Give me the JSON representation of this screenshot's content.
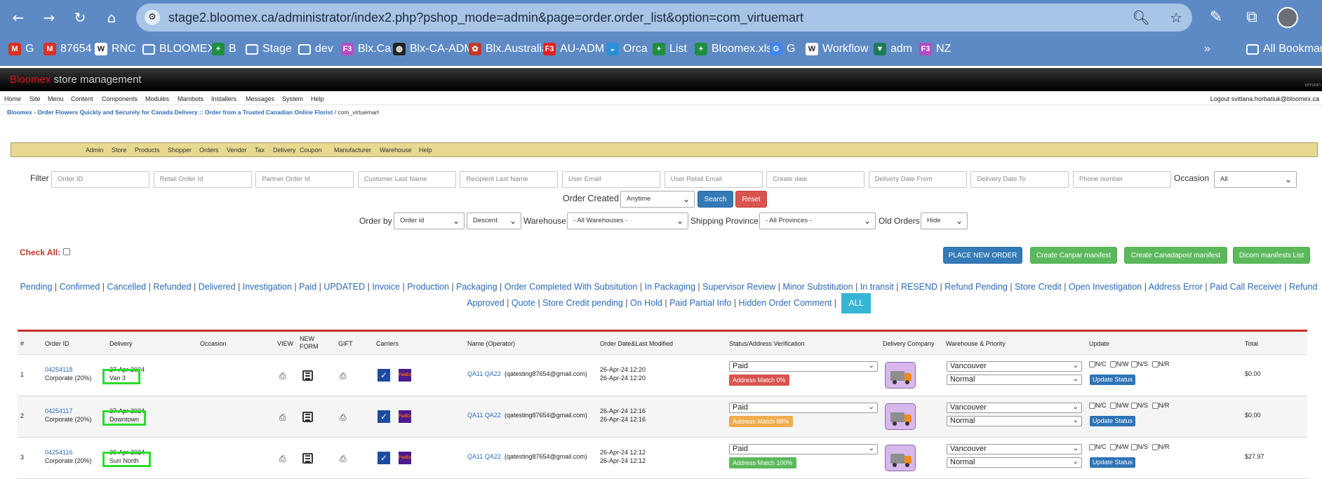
{
  "browser": {
    "url": "stage2.bloomex.ca/administrator/index2.php?pshop_mode=admin&page=order.order_list&option=com_virtuemart",
    "bookmarks": [
      {
        "label": "G",
        "icon": "gmail-icon",
        "color": "#d93025"
      },
      {
        "label": "87654",
        "icon": "gmail-icon",
        "color": "#d93025"
      },
      {
        "label": "RNC",
        "icon": "wiki-icon",
        "color": "#ffffff"
      },
      {
        "label": "BLOOMEX",
        "icon": "folder-icon",
        "color": "#ffffff"
      },
      {
        "label": "B",
        "icon": "sheets-icon",
        "color": "#1e8e3e"
      },
      {
        "label": "Stage",
        "icon": "folder-icon",
        "color": "#ffffff"
      },
      {
        "label": "dev",
        "icon": "folder-icon",
        "color": "#ffffff"
      },
      {
        "label": "Blx.Ca",
        "icon": "f3-icon",
        "color": "#b04fc4"
      },
      {
        "label": "Blx-CA-ADM",
        "icon": "globe-icon",
        "color": "#222222"
      },
      {
        "label": "Blx.Australia",
        "icon": "bloomex-icon",
        "color": "#c0392b"
      },
      {
        "label": "AU-ADM",
        "icon": "f3-icon",
        "color": "#e02020"
      },
      {
        "label": "Orca",
        "icon": "orca-icon",
        "color": "#2a8fd8"
      },
      {
        "label": "List",
        "icon": "sheets-icon",
        "color": "#1e8e3e"
      },
      {
        "label": "Bloomex.xlsx",
        "icon": "sheets-icon",
        "color": "#1e8e3e"
      },
      {
        "label": "G",
        "icon": "translate-icon",
        "color": "#4285f4"
      },
      {
        "label": "Workflow",
        "icon": "wiki-icon",
        "color": "#ffffff"
      },
      {
        "label": "adm",
        "icon": "vuetify-icon",
        "color": "#1f7a5a"
      },
      {
        "label": "NZ",
        "icon": "f3-icon",
        "color": "#b04fc4"
      }
    ],
    "overflow_label": "»",
    "all_bookmarks": "All Bookmarks"
  },
  "app": {
    "brand": "Bloomex",
    "title_rest": " store management",
    "version": "version",
    "menu": [
      "Home",
      "Site",
      "Menu",
      "Content",
      "Components",
      "Modules",
      "Mambots",
      "Installers",
      "Messages",
      "System",
      "Help"
    ],
    "logout": "Logout svitlana.horbatiuk@bloomex.ca",
    "breadcrumb_link": "Bloomex - Order Flowers Quickly and Securely for Canada Delivery :: Order from a Trusted Canadian Online Florist",
    "breadcrumb_rest": " / com_virtuemart",
    "submenu": [
      "Admin",
      "Store",
      "Products",
      "Shopper",
      "Orders",
      "Vendor",
      "Tax",
      "Delivery",
      "Coupon",
      "Manufacturer",
      "Warehouse",
      "Help"
    ]
  },
  "filters": {
    "filter_label": "Filter",
    "placeholders": [
      "Order ID",
      "Retail Order Id",
      "Partner Order Id",
      "Customer Last Name",
      "Recipient Last Name",
      "User Email",
      "User Retail Email",
      "Create date",
      "Delivery Date From",
      "Delivery Date To",
      "Phone number"
    ],
    "occasion_label": "Occasion",
    "occasion_value": "All",
    "order_created_label": "Order Created",
    "order_created_value": "Anytime",
    "search": "Search",
    "reset": "Reset",
    "order_by_label": "Order by",
    "order_by_value": "Order id",
    "direction_value": "Descent",
    "warehouse_label": "Warehouse",
    "warehouse_value": "- All Warehouses -",
    "province_label": "Shipping Province",
    "province_value": "- All Provinces -",
    "old_orders_label": "Old Orders",
    "old_orders_value": "Hide"
  },
  "actions": {
    "check_all": "Check All:",
    "place_new_order": "PLACE NEW ORDER",
    "canpar": "Create Canpar manifest",
    "canadapost": "Create Canadapost manifest",
    "dicom": "Dicom manifests List"
  },
  "status_links_line1": [
    "Pending",
    "Confirmed",
    "Cancelled",
    "Refunded",
    "Delivered",
    "Investigation",
    "Paid",
    "UPDATED",
    "Invoice",
    "Production",
    "Packaging",
    "Order Completed With Subsitution",
    "In Packaging",
    "Supervisor Review",
    "Minor Substitution",
    "In transit",
    "RESEND",
    "Refund Pending",
    "Store Credit",
    "Open Investigation",
    "Address Error",
    "Paid Call"
  ],
  "status_links_line2": [
    "Receiver",
    "Refund Approved",
    "Quote",
    "Store Credit pending",
    "On Hold",
    "Paid Partial Info",
    "Hidden Order Comment"
  ],
  "status_all": "ALL",
  "table": {
    "headers": [
      "#",
      "Order ID",
      "Delivery",
      "Occasion",
      "VIEW",
      "NEW FORM",
      "GIFT",
      "Carriers",
      "Name (Operator)",
      "Order Date&Last Modified",
      "Status/Address Verification",
      "Delivery Company",
      "Warehouse & Priority",
      "Update",
      "Total"
    ],
    "rows": [
      {
        "num": "1",
        "order_id": "04254118",
        "corp": "Corporate (20%)",
        "date": "27-Apr-2024",
        "delivery": "Van 3",
        "name": "QA11 QA22",
        "email": "(qatesting87654@gmail.com)",
        "created": "26-Apr-24 12:20",
        "modified": "26-Apr-24 12:20",
        "status": "Paid",
        "match": "Address Match 0%",
        "match_color": "#d9534f",
        "warehouse": "Vancouver",
        "priority": "Normal",
        "total": "$0.00"
      },
      {
        "num": "2",
        "order_id": "04254117",
        "corp": "Corporate (20%)",
        "date": "27-Apr-2024",
        "delivery": "Downtown",
        "name": "QA11 QA22",
        "email": "(qatesting87654@gmail.com)",
        "created": "26-Apr-24 12:16",
        "modified": "26-Apr-24 12:16",
        "status": "Paid",
        "match": "Address Match 88%",
        "match_color": "#f0ad4e",
        "warehouse": "Vancouver",
        "priority": "Normal",
        "total": "$0.00"
      },
      {
        "num": "3",
        "order_id": "04254116",
        "corp": "Corporate (20%)",
        "date": "30-Apr-2024",
        "delivery": "Surr North",
        "name": "QA11 QA22",
        "email": "(qatesting87654@gmail.com)",
        "created": "26-Apr-24 12:12",
        "modified": "26-Apr-24 12:12",
        "status": "Paid",
        "match": "Address Match 100%",
        "match_color": "#5cb85c",
        "warehouse": "Vancouver",
        "priority": "Normal",
        "total": "$27.97"
      }
    ],
    "update_checks": [
      "N/C",
      "N/W",
      "N/S",
      "N/R"
    ],
    "update_button": "Update Status"
  }
}
